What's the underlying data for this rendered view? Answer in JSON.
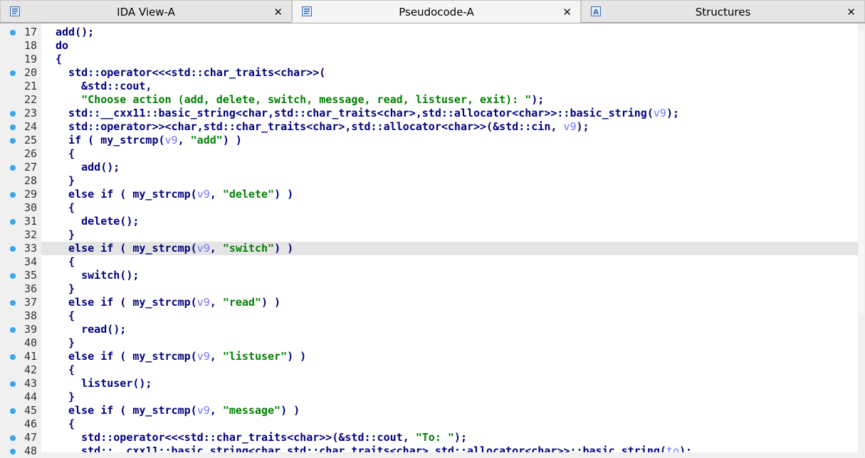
{
  "tabs": [
    {
      "label": "IDA View-A",
      "icon": "ida-view-icon",
      "active": false
    },
    {
      "label": "Pseudocode-A",
      "icon": "pseudocode-icon",
      "active": true
    },
    {
      "label": "Structures",
      "icon": "structures-icon",
      "active": false
    }
  ],
  "close_glyph": "✕",
  "colors": {
    "keyword": "#000080",
    "string": "#008000",
    "variable": "#7373ff",
    "breakpoint_dot": "#39a6e8",
    "highlight": "#e4e4e4"
  },
  "highlighted_line": 33,
  "lines": [
    {
      "num": "17",
      "dot": true,
      "tokens": [
        [
          "k",
          "add();"
        ]
      ]
    },
    {
      "num": "18",
      "dot": false,
      "tokens": [
        [
          "k",
          "do"
        ]
      ]
    },
    {
      "num": "19",
      "dot": false,
      "tokens": [
        [
          "k",
          "{"
        ]
      ]
    },
    {
      "num": "20",
      "dot": true,
      "tokens": [
        [
          "k",
          "  std::operator<<<std::char_traits<char>>("
        ]
      ]
    },
    {
      "num": "21",
      "dot": false,
      "tokens": [
        [
          "k",
          "    &std::cout,"
        ]
      ]
    },
    {
      "num": "22",
      "dot": false,
      "tokens": [
        [
          "s",
          "    \"Choose action (add, delete, switch, message, read, listuser, exit): \""
        ],
        [
          "k",
          ");"
        ]
      ]
    },
    {
      "num": "23",
      "dot": true,
      "tokens": [
        [
          "k",
          "  std::__cxx11::basic_string<char,std::char_traits<char>,std::allocator<char>>::basic_string("
        ],
        [
          "v",
          "v9"
        ],
        [
          "k",
          ");"
        ]
      ]
    },
    {
      "num": "24",
      "dot": true,
      "tokens": [
        [
          "k",
          "  std::operator>><char,std::char_traits<char>,std::allocator<char>>(&std::cin, "
        ],
        [
          "v",
          "v9"
        ],
        [
          "k",
          ");"
        ]
      ]
    },
    {
      "num": "25",
      "dot": true,
      "tokens": [
        [
          "k",
          "  if ( my_strcmp("
        ],
        [
          "v",
          "v9"
        ],
        [
          "k",
          ", "
        ],
        [
          "s",
          "\"add\""
        ],
        [
          "k",
          ") )"
        ]
      ]
    },
    {
      "num": "26",
      "dot": false,
      "tokens": [
        [
          "k",
          "  {"
        ]
      ]
    },
    {
      "num": "27",
      "dot": true,
      "tokens": [
        [
          "k",
          "    add();"
        ]
      ]
    },
    {
      "num": "28",
      "dot": false,
      "tokens": [
        [
          "k",
          "  }"
        ]
      ]
    },
    {
      "num": "29",
      "dot": true,
      "tokens": [
        [
          "k",
          "  else if ( my_strcmp("
        ],
        [
          "v",
          "v9"
        ],
        [
          "k",
          ", "
        ],
        [
          "s",
          "\"delete\""
        ],
        [
          "k",
          ") )"
        ]
      ]
    },
    {
      "num": "30",
      "dot": false,
      "tokens": [
        [
          "k",
          "  {"
        ]
      ]
    },
    {
      "num": "31",
      "dot": true,
      "tokens": [
        [
          "k",
          "    delete();"
        ]
      ]
    },
    {
      "num": "32",
      "dot": false,
      "tokens": [
        [
          "k",
          "  }"
        ]
      ]
    },
    {
      "num": "33",
      "dot": true,
      "tokens": [
        [
          "k",
          "  else if ( my_strcmp("
        ],
        [
          "v",
          "v9"
        ],
        [
          "k",
          ", "
        ],
        [
          "s",
          "\"switch\""
        ],
        [
          "k",
          ") )"
        ]
      ]
    },
    {
      "num": "34",
      "dot": false,
      "tokens": [
        [
          "k",
          "  {"
        ]
      ]
    },
    {
      "num": "35",
      "dot": true,
      "tokens": [
        [
          "k",
          "    switch();"
        ]
      ]
    },
    {
      "num": "36",
      "dot": false,
      "tokens": [
        [
          "k",
          "  }"
        ]
      ]
    },
    {
      "num": "37",
      "dot": true,
      "tokens": [
        [
          "k",
          "  else if ( my_strcmp("
        ],
        [
          "v",
          "v9"
        ],
        [
          "k",
          ", "
        ],
        [
          "s",
          "\"read\""
        ],
        [
          "k",
          ") )"
        ]
      ]
    },
    {
      "num": "38",
      "dot": false,
      "tokens": [
        [
          "k",
          "  {"
        ]
      ]
    },
    {
      "num": "39",
      "dot": true,
      "tokens": [
        [
          "k",
          "    read();"
        ]
      ]
    },
    {
      "num": "40",
      "dot": false,
      "tokens": [
        [
          "k",
          "  }"
        ]
      ]
    },
    {
      "num": "41",
      "dot": true,
      "tokens": [
        [
          "k",
          "  else if ( my_strcmp("
        ],
        [
          "v",
          "v9"
        ],
        [
          "k",
          ", "
        ],
        [
          "s",
          "\"listuser\""
        ],
        [
          "k",
          ") )"
        ]
      ]
    },
    {
      "num": "42",
      "dot": false,
      "tokens": [
        [
          "k",
          "  {"
        ]
      ]
    },
    {
      "num": "43",
      "dot": true,
      "tokens": [
        [
          "k",
          "    listuser();"
        ]
      ]
    },
    {
      "num": "44",
      "dot": false,
      "tokens": [
        [
          "k",
          "  }"
        ]
      ]
    },
    {
      "num": "45",
      "dot": true,
      "tokens": [
        [
          "k",
          "  else if ( my_strcmp("
        ],
        [
          "v",
          "v9"
        ],
        [
          "k",
          ", "
        ],
        [
          "s",
          "\"message\""
        ],
        [
          "k",
          ") )"
        ]
      ]
    },
    {
      "num": "46",
      "dot": false,
      "tokens": [
        [
          "k",
          "  {"
        ]
      ]
    },
    {
      "num": "47",
      "dot": true,
      "tokens": [
        [
          "k",
          "    std::operator<<<std::char_traits<char>>(&std::cout, "
        ],
        [
          "s",
          "\"To: \""
        ],
        [
          "k",
          ");"
        ]
      ]
    },
    {
      "num": "48",
      "dot": true,
      "tokens": [
        [
          "k",
          "    std::__cxx11::basic_string<char,std::char_traits<char>,std::allocator<char>>::basic_string("
        ],
        [
          "v",
          "to"
        ],
        [
          "k",
          ");"
        ]
      ]
    }
  ]
}
